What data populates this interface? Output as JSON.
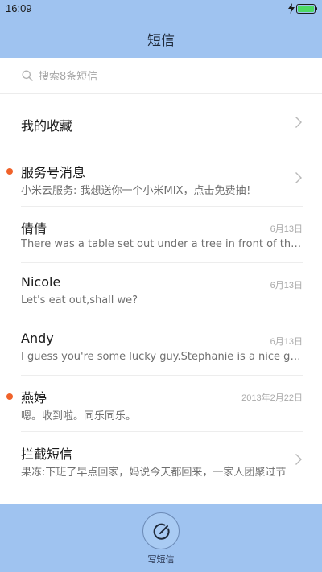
{
  "status_bar": {
    "time": "16:09"
  },
  "header": {
    "title": "短信"
  },
  "search": {
    "placeholder": "搜索8条短信"
  },
  "favorites": {
    "label": "我的收藏"
  },
  "conversations": [
    {
      "name": "服务号消息",
      "preview": "小米云服务: 我想送你一个小米MIX，点击免费抽！",
      "date": "",
      "unread": true,
      "chevron": true
    },
    {
      "name": "倩倩",
      "preview": "There was a table set out under a tree in front of the house",
      "date": "6月13日",
      "unread": false,
      "chevron": false
    },
    {
      "name": "Nicole",
      "preview": "Let's eat out,shall we?",
      "date": "6月13日",
      "unread": false,
      "chevron": false
    },
    {
      "name": "Andy",
      "preview": "I guess you're some lucky guy.Stephanie is a nice girl.",
      "date": "6月13日",
      "unread": false,
      "chevron": false
    },
    {
      "name": "燕婷",
      "preview": "嗯。收到啦。同乐同乐。",
      "date": "2013年2月22日",
      "unread": true,
      "chevron": false
    },
    {
      "name": "拦截短信",
      "preview": "果冻:下班了早点回家，妈说今天都回来，一家人团聚过节",
      "date": "",
      "unread": false,
      "chevron": true
    }
  ],
  "bottom_bar": {
    "compose_label": "写短信"
  },
  "colors": {
    "accent": "#9fc3f0",
    "unread": "#f0622a",
    "battery": "#4cd964"
  }
}
